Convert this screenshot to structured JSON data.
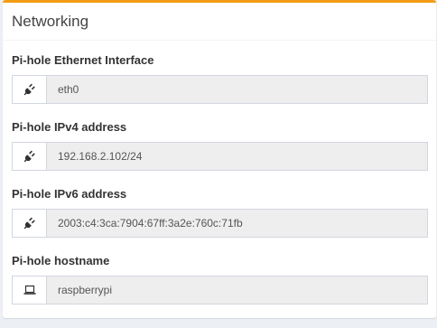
{
  "panel": {
    "title": "Networking",
    "accent_color": "#f39c12"
  },
  "fields": [
    {
      "label": "Pi-hole Ethernet Interface",
      "value": "eth0",
      "icon": "plug-icon"
    },
    {
      "label": "Pi-hole IPv4 address",
      "value": "192.168.2.102/24",
      "icon": "plug-icon"
    },
    {
      "label": "Pi-hole IPv6 address",
      "value": "2003:c4:3ca:7904:67ff:3a2e:760c:71fb",
      "icon": "plug-icon"
    },
    {
      "label": "Pi-hole hostname",
      "value": "raspberrypi",
      "icon": "laptop-icon"
    }
  ]
}
